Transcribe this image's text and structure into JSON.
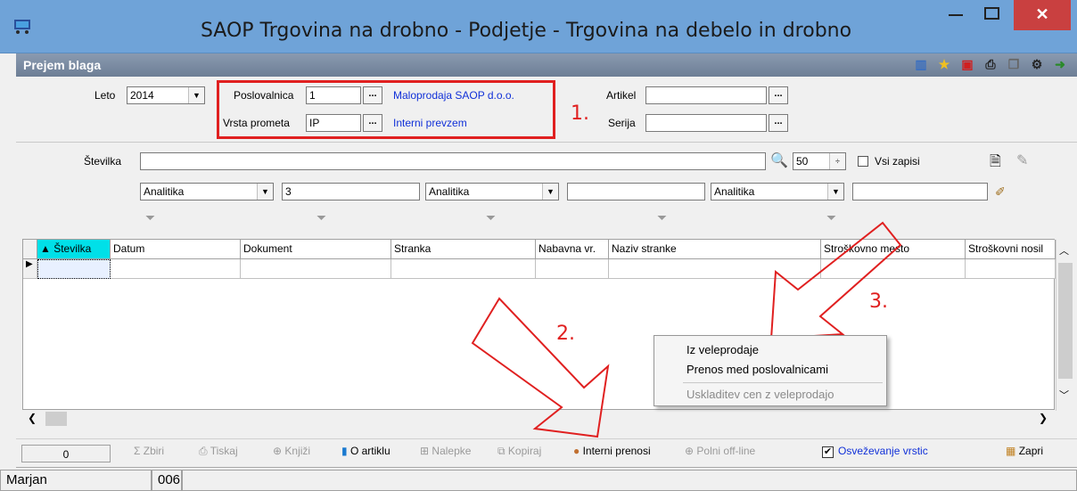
{
  "window": {
    "title": "SAOP Trgovina na drobno - Podjetje - Trgovina na debelo in drobno",
    "close_label": "✕"
  },
  "module": {
    "title": "Prejem blaga"
  },
  "filters": {
    "leto_label": "Leto",
    "leto_value": "2014",
    "poslovalnica_label": "Poslovalnica",
    "poslovalnica_value": "1",
    "poslovalnica_name": "Maloprodaja SAOP d.o.o.",
    "vrsta_label": "Vrsta prometa",
    "vrsta_value": "IP",
    "vrsta_name": "Interni prevzem",
    "artikel_label": "Artikel",
    "artikel_value": "",
    "serija_label": "Serija",
    "serija_value": "",
    "dots": "...",
    "stevilka_label": "Številka",
    "stevilka_value": "",
    "count_value": "50",
    "vsi_zapisi_label": "Vsi zapisi",
    "analitika": [
      {
        "select": "Analitika",
        "value": "3"
      },
      {
        "select": "Analitika",
        "value": ""
      },
      {
        "select": "Analitika",
        "value": ""
      }
    ]
  },
  "annotations": {
    "one": "1.",
    "two": "2.",
    "three": "3."
  },
  "grid": {
    "columns": [
      "Številka",
      "Datum",
      "Dokument",
      "Stranka",
      "Nabavna vr.",
      "Naziv stranke",
      "Stroškovno mesto",
      "Stroškovni nosil"
    ]
  },
  "context_menu": {
    "items": [
      "Iz veleprodaje",
      "Prenos med poslovalnicami",
      "Uskladitev cen z veleprodajo"
    ]
  },
  "toolbar": {
    "count": "0",
    "zbiri": "Zbiri",
    "tiskaj": "Tiskaj",
    "knjizi": "Knjiži",
    "o_artiklu": "O artiklu",
    "nalepke": "Nalepke",
    "kopiraj": "Kopiraj",
    "interni_prenosi": "Interni prenosi",
    "polni_offline": "Polni off-line",
    "osvezevanje": "Osveževanje vrstic",
    "zapri": "Zapri"
  },
  "status": {
    "user": "Marjan",
    "code": "006"
  }
}
